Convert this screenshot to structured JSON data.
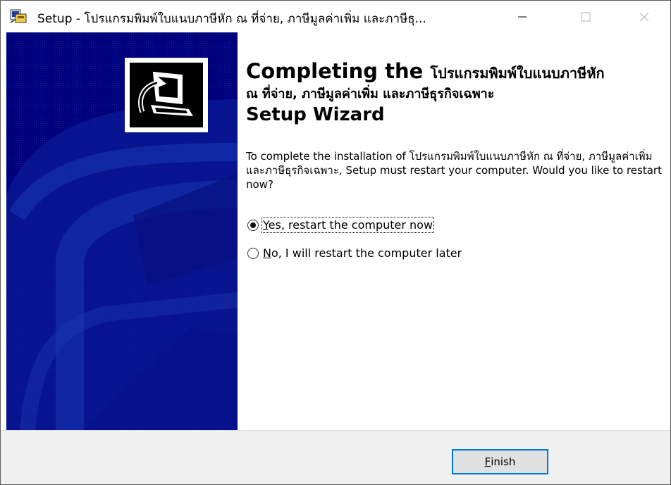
{
  "window": {
    "title": "Setup - โปรแกรมพิมพ์ใบแนบภาษีหัก ณ ที่จ่าย, ภาษีมูลค่าเพิ่ม และภาษีธุ..."
  },
  "heading": {
    "line1_bold": "Completing the ",
    "line1_thai": "โปรแกรมพิมพ์ใบแนบภาษีหัก",
    "line2": "ณ ที่จ่าย, ภาษีมูลค่าเพิ่ม และภาษีธุรกิจเฉพาะ",
    "line3": "Setup Wizard"
  },
  "description": "To complete the installation of โปรแกรมพิมพ์ใบแนบภาษีหัก ณ ที่จ่าย, ภาษีมูลค่าเพิ่ม และภาษีธุรกิจเฉพาะ, Setup must restart your computer. Would you like to restart now?",
  "options": {
    "yes": {
      "accel": "Y",
      "rest": "es, restart the computer now",
      "checked": true
    },
    "no": {
      "accel": "N",
      "rest": "o, I will restart the computer later",
      "checked": false
    }
  },
  "footer": {
    "finish_accel": "F",
    "finish_rest": "inish"
  },
  "colors": {
    "sidebar": "#00007b",
    "focus_border": "#0078d7",
    "footer_bg": "#f0f0f0"
  },
  "icons": [
    "setup-app-icon",
    "minimize-icon",
    "maximize-icon",
    "close-icon",
    "computer-install-icon"
  ]
}
